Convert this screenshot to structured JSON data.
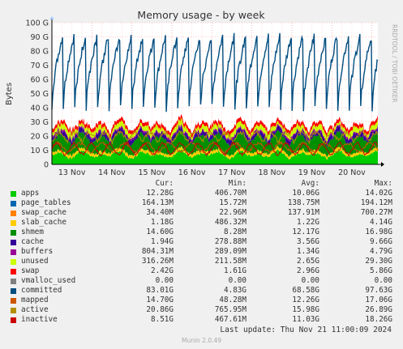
{
  "chart_data": {
    "type": "area",
    "title": "Memory usage - by week",
    "ylabel": "Bytes",
    "side_label": "RRDTOOL / TOBI OETIKER",
    "y_ticks": [
      "0",
      "10 G",
      "20 G",
      "30 G",
      "40 G",
      "50 G",
      "60 G",
      "70 G",
      "80 G",
      "90 G",
      "100 G"
    ],
    "ylim_gb": [
      0,
      100
    ],
    "x_ticks": [
      "13 Nov",
      "14 Nov",
      "15 Nov",
      "16 Nov",
      "17 Nov",
      "18 Nov",
      "19 Nov",
      "20 Nov"
    ],
    "grid": true,
    "approx_levels_gb": {
      "committed_range": [
        40,
        92
      ],
      "swap_top": 34,
      "unused_top": 30,
      "apps_base": 12,
      "inactive_typical": 10
    }
  },
  "legend": {
    "headers": [
      "Cur:",
      "Min:",
      "Avg:",
      "Max:"
    ],
    "rows": [
      {
        "name": "apps",
        "color": "#00cc00",
        "cur": "12.28G",
        "min": "406.70M",
        "avg": "10.06G",
        "max": "14.02G"
      },
      {
        "name": "page_tables",
        "color": "#0066b3",
        "cur": "164.13M",
        "min": "15.72M",
        "avg": "138.75M",
        "max": "194.12M"
      },
      {
        "name": "swap_cache",
        "color": "#ff8000",
        "cur": "34.40M",
        "min": "22.96M",
        "avg": "137.91M",
        "max": "700.27M"
      },
      {
        "name": "slab_cache",
        "color": "#ffcc00",
        "cur": "1.18G",
        "min": "486.32M",
        "avg": "1.22G",
        "max": "4.14G"
      },
      {
        "name": "shmem",
        "color": "#008f00",
        "cur": "14.60G",
        "min": "8.28M",
        "avg": "12.17G",
        "max": "16.98G"
      },
      {
        "name": "cache",
        "color": "#330099",
        "cur": "1.94G",
        "min": "278.88M",
        "avg": "3.56G",
        "max": "9.66G"
      },
      {
        "name": "buffers",
        "color": "#990099",
        "cur": "804.31M",
        "min": "289.09M",
        "avg": "1.34G",
        "max": "4.79G"
      },
      {
        "name": "unused",
        "color": "#ccff00",
        "cur": "316.26M",
        "min": "211.58M",
        "avg": "2.65G",
        "max": "29.30G"
      },
      {
        "name": "swap",
        "color": "#ff0000",
        "cur": "2.42G",
        "min": "1.61G",
        "avg": "2.96G",
        "max": "5.86G"
      },
      {
        "name": "vmalloc_used",
        "color": "#808080",
        "cur": "0.00",
        "min": "0.00",
        "avg": "0.00",
        "max": "0.00"
      },
      {
        "name": "committed",
        "color": "#004d80",
        "cur": "83.01G",
        "min": "4.83G",
        "avg": "68.58G",
        "max": "97.63G"
      },
      {
        "name": "mapped",
        "color": "#cc5500",
        "cur": "14.70G",
        "min": "48.28M",
        "avg": "12.26G",
        "max": "17.06G"
      },
      {
        "name": "active",
        "color": "#b38f00",
        "cur": "20.86G",
        "min": "765.95M",
        "avg": "15.98G",
        "max": "26.89G"
      },
      {
        "name": "inactive",
        "color": "#cc0000",
        "cur": "8.51G",
        "min": "467.61M",
        "avg": "11.03G",
        "max": "18.26G"
      }
    ]
  },
  "footer": {
    "last_update": "Last update: Thu Nov 21 11:00:09 2024",
    "munin_version": "Munin 2.0.49"
  },
  "colors": {
    "background": "#f0f0f0",
    "plot_background": "#ffffff",
    "grid_minor": "#ff9999",
    "axis": "#000000"
  }
}
